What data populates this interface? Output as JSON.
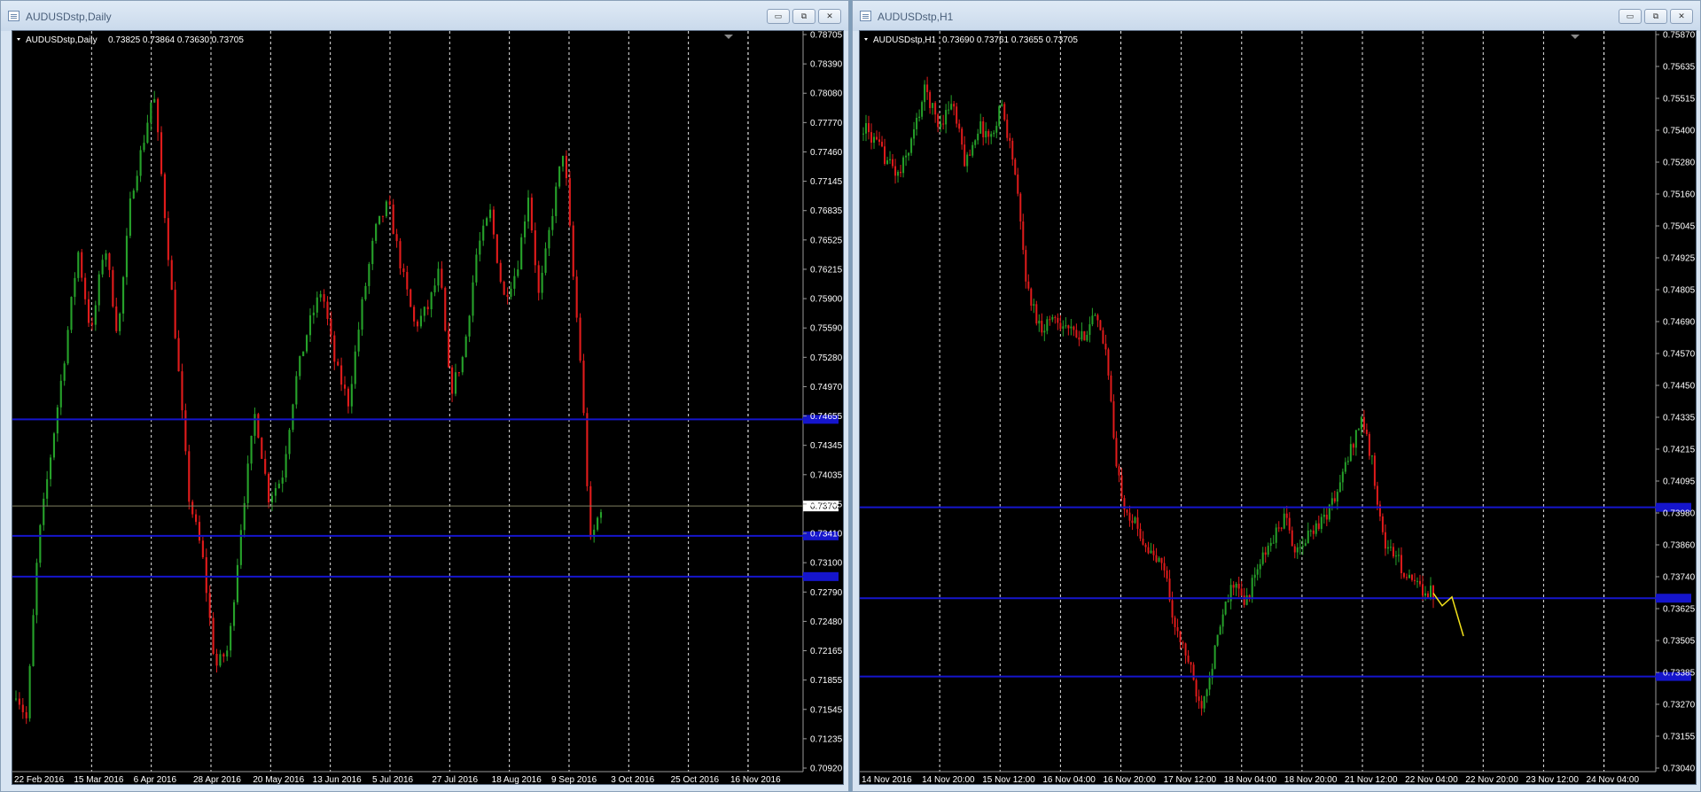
{
  "windows": [
    {
      "title": "AUDUSDstp,Daily",
      "symbol": "AUDUSDstp,Daily",
      "ohlc": "0.73825 0.73864 0.73630 0.73705",
      "close_label": "0.73705",
      "chart_data": {
        "type": "candlestick",
        "ylim": [
          0.7092,
          0.787
        ],
        "y_ticks": [
          "0.78705",
          "0.78390",
          "0.78080",
          "0.77770",
          "0.77460",
          "0.77145",
          "0.76835",
          "0.76525",
          "0.76215",
          "0.75900",
          "0.75590",
          "0.75280",
          "0.74970",
          "0.74655",
          "0.74345",
          "0.74035",
          "0.73705",
          "0.73410",
          "0.73100",
          "0.72790",
          "0.72480",
          "0.72165",
          "0.71855",
          "0.71545",
          "0.71235",
          "0.70920"
        ],
        "x_ticks": [
          "22 Feb 2016",
          "15 Mar 2016",
          "6 Apr 2016",
          "28 Apr 2016",
          "20 May 2016",
          "13 Jun 2016",
          "5 Jul 2016",
          "27 Jul 2016",
          "18 Aug 2016",
          "9 Sep 2016",
          "3 Oct 2016",
          "25 Oct 2016",
          "16 Nov 2016"
        ],
        "hlines": [
          0.7462,
          0.7339,
          0.7296
        ],
        "current_price": 0.73705,
        "path": [
          [
            0,
            0.7175
          ],
          [
            12,
            0.7145
          ],
          [
            25,
            0.733
          ],
          [
            40,
            0.743
          ],
          [
            55,
            0.753
          ],
          [
            70,
            0.764
          ],
          [
            85,
            0.755
          ],
          [
            100,
            0.765
          ],
          [
            115,
            0.755
          ],
          [
            130,
            0.77
          ],
          [
            145,
            0.776
          ],
          [
            155,
            0.781
          ],
          [
            165,
            0.771
          ],
          [
            180,
            0.755
          ],
          [
            195,
            0.738
          ],
          [
            210,
            0.732
          ],
          [
            225,
            0.72
          ],
          [
            240,
            0.722
          ],
          [
            255,
            0.736
          ],
          [
            270,
            0.747
          ],
          [
            285,
            0.738
          ],
          [
            300,
            0.74
          ],
          [
            315,
            0.75
          ],
          [
            330,
            0.756
          ],
          [
            345,
            0.76
          ],
          [
            360,
            0.752
          ],
          [
            375,
            0.748
          ],
          [
            390,
            0.758
          ],
          [
            405,
            0.766
          ],
          [
            420,
            0.769
          ],
          [
            435,
            0.762
          ],
          [
            450,
            0.756
          ],
          [
            465,
            0.758
          ],
          [
            478,
            0.762
          ],
          [
            490,
            0.749
          ],
          [
            505,
            0.753
          ],
          [
            520,
            0.764
          ],
          [
            535,
            0.768
          ],
          [
            550,
            0.759
          ],
          [
            565,
            0.762
          ],
          [
            578,
            0.77
          ],
          [
            590,
            0.759
          ],
          [
            605,
            0.768
          ],
          [
            618,
            0.775
          ],
          [
            628,
            0.762
          ],
          [
            638,
            0.751
          ],
          [
            648,
            0.733
          ],
          [
            660,
            0.737
          ]
        ],
        "n_candles": 170
      }
    },
    {
      "title": "AUDUSDstp,H1",
      "symbol": "AUDUSDstp,H1",
      "ohlc": "0.73690 0.73761 0.73655 0.73705",
      "close_label": "0.73705",
      "chart_data": {
        "type": "candlestick",
        "ylim": [
          0.73,
          0.7592
        ],
        "y_ticks": [
          "0.75870",
          "0.75635",
          "0.75515",
          "0.75400",
          "0.75280",
          "0.75160",
          "0.75045",
          "0.74925",
          "0.74805",
          "0.74690",
          "0.74570",
          "0.74450",
          "0.74335",
          "0.74215",
          "0.74095",
          "0.73980",
          "0.73860",
          "0.73740",
          "0.73625",
          "0.73505",
          "0.73385",
          "0.73270",
          "0.73155",
          "0.73040"
        ],
        "x_ticks": [
          "14 Nov 2016",
          "14 Nov 20:00",
          "15 Nov 12:00",
          "16 Nov 04:00",
          "16 Nov 20:00",
          "17 Nov 12:00",
          "18 Nov 04:00",
          "18 Nov 20:00",
          "21 Nov 12:00",
          "22 Nov 04:00",
          "22 Nov 20:00",
          "23 Nov 12:00",
          "24 Nov 04:00"
        ],
        "hlines": [
          0.7404,
          0.7368,
          0.7337
        ],
        "path": [
          [
            0,
            0.7555
          ],
          [
            20,
            0.7545
          ],
          [
            40,
            0.7535
          ],
          [
            55,
            0.755
          ],
          [
            70,
            0.757
          ],
          [
            85,
            0.7555
          ],
          [
            100,
            0.7565
          ],
          [
            115,
            0.754
          ],
          [
            130,
            0.7555
          ],
          [
            145,
            0.755
          ],
          [
            155,
            0.7565
          ],
          [
            170,
            0.754
          ],
          [
            185,
            0.749
          ],
          [
            200,
            0.7475
          ],
          [
            215,
            0.748
          ],
          [
            230,
            0.7475
          ],
          [
            245,
            0.747
          ],
          [
            260,
            0.748
          ],
          [
            275,
            0.7465
          ],
          [
            285,
            0.742
          ],
          [
            295,
            0.7405
          ],
          [
            310,
            0.7395
          ],
          [
            325,
            0.7385
          ],
          [
            340,
            0.738
          ],
          [
            352,
            0.7355
          ],
          [
            365,
            0.7345
          ],
          [
            380,
            0.7325
          ],
          [
            392,
            0.734
          ],
          [
            405,
            0.736
          ],
          [
            418,
            0.7375
          ],
          [
            430,
            0.7365
          ],
          [
            445,
            0.738
          ],
          [
            460,
            0.739
          ],
          [
            475,
            0.74
          ],
          [
            490,
            0.7385
          ],
          [
            505,
            0.7395
          ],
          [
            520,
            0.74
          ],
          [
            535,
            0.741
          ],
          [
            548,
            0.7425
          ],
          [
            562,
            0.744
          ],
          [
            575,
            0.742
          ],
          [
            587,
            0.739
          ],
          [
            600,
            0.7385
          ],
          [
            615,
            0.7375
          ],
          [
            630,
            0.7372
          ],
          [
            643,
            0.737
          ]
        ],
        "n_candles": 215,
        "projection": [
          [
            643,
            0.737
          ],
          [
            653,
            0.7365
          ],
          [
            664,
            0.73685
          ],
          [
            677,
            0.7353
          ]
        ]
      }
    }
  ],
  "colors": {
    "bull": "#26a12a",
    "bear": "#e01b1b",
    "hline": "#1515cc",
    "grid": "#ffffff",
    "projection": "#f3e21a",
    "background": "#000000"
  }
}
